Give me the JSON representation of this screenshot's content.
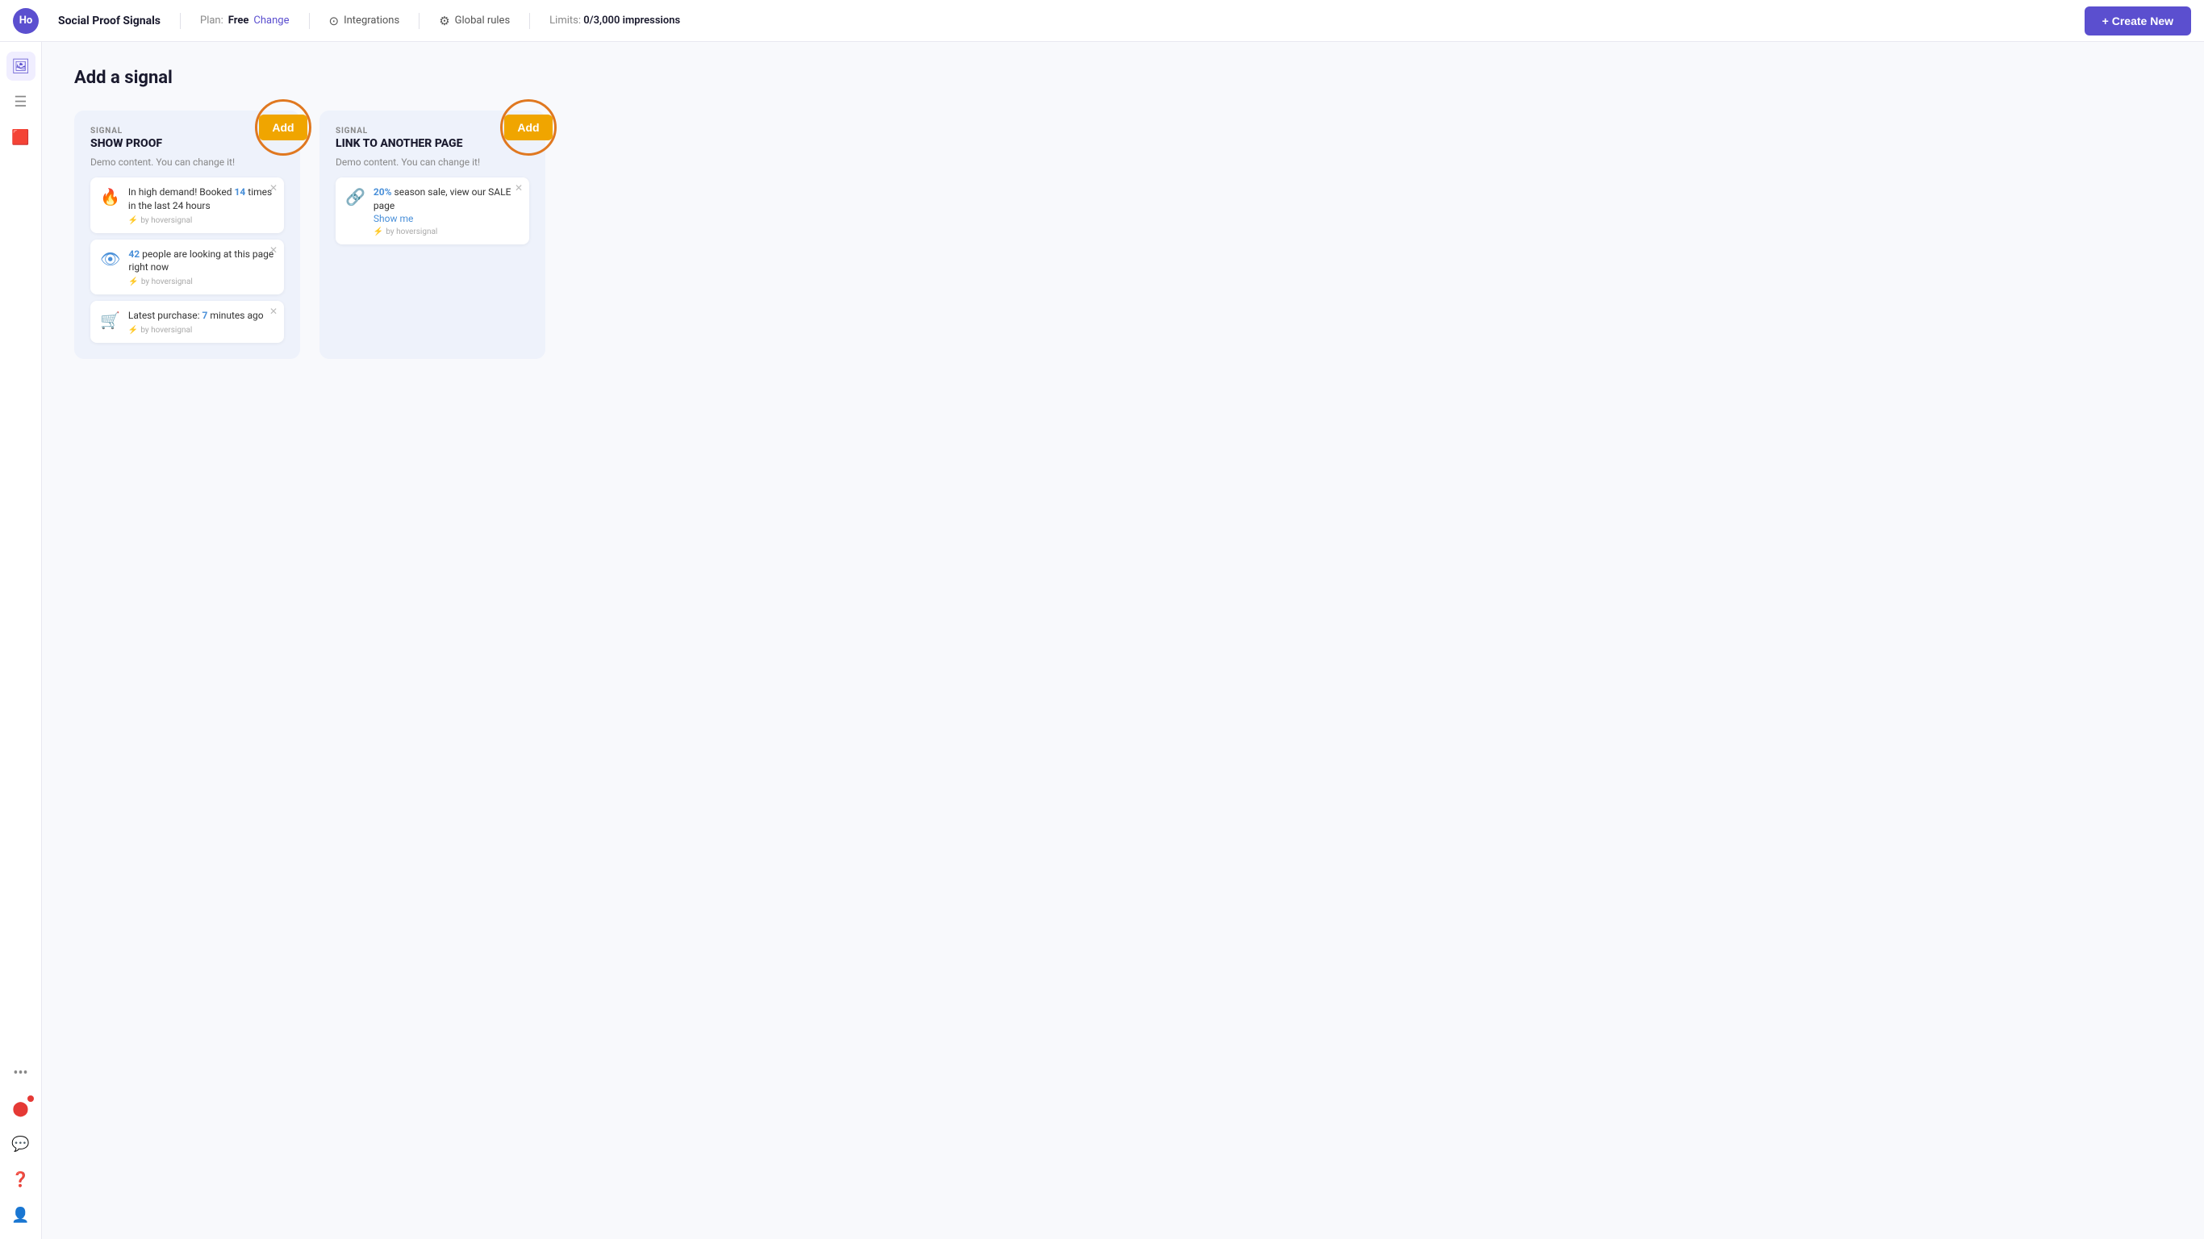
{
  "topnav": {
    "avatar_initials": "Ho",
    "title": "Social Proof Signals",
    "plan_label": "Plan:",
    "plan_value": "Free",
    "change_label": "Change",
    "integrations_label": "Integrations",
    "global_rules_label": "Global rules",
    "limits_label": "Limits:",
    "limits_value": "0/3,000 impressions",
    "create_new_label": "+ Create New"
  },
  "sidebar": {
    "icons": [
      "🖼",
      "☰",
      "🟥",
      "⋯",
      "🔴",
      "💬",
      "❓",
      "👤"
    ]
  },
  "page": {
    "title": "Add a signal"
  },
  "signals": [
    {
      "id": "show-proof",
      "signal_label": "SIGNAL",
      "signal_name": "SHOW PROOF",
      "add_btn": "Add",
      "demo_text": "Demo content. You can change it!",
      "notifications": [
        {
          "icon_type": "fire",
          "icon_char": "🔥",
          "text_before": "In high demand! Booked ",
          "highlight": "14",
          "text_after": " times in the last 24 hours",
          "brand": "by hoversignal"
        },
        {
          "icon_type": "eye",
          "icon_char": "👁",
          "text_before": "",
          "highlight": "42",
          "text_after": " people are looking at this page right now",
          "brand": "by hoversignal"
        },
        {
          "icon_type": "cart",
          "icon_char": "🛒",
          "text_before": "Latest purchase: ",
          "highlight": "7",
          "text_after": " minutes ago",
          "brand": "by hoversignal"
        }
      ]
    },
    {
      "id": "link-to-page",
      "signal_label": "SIGNAL",
      "signal_name": "LINK TO ANOTHER PAGE",
      "add_btn": "Add",
      "demo_text": "Demo content. You can change it!",
      "notifications": [
        {
          "icon_type": "link",
          "icon_char": "🔗",
          "text_before": "",
          "highlight": "20%",
          "text_after": " season sale, view our SALE page",
          "show_me": "Show me",
          "brand": "by hoversignal"
        }
      ]
    }
  ]
}
